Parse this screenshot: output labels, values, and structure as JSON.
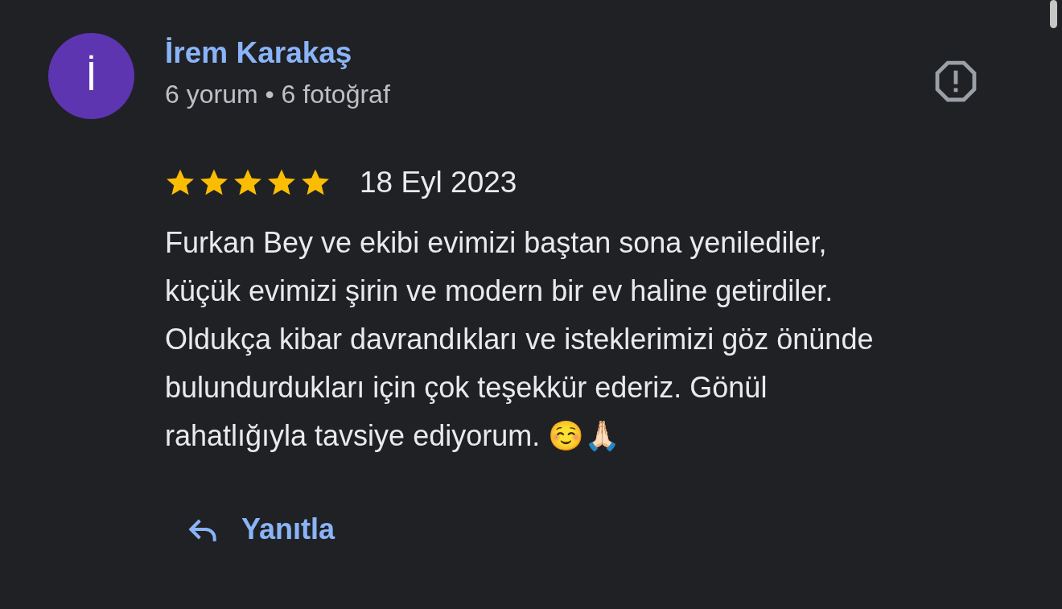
{
  "review": {
    "avatar_letter": "İ",
    "author": "İrem Karakaş",
    "author_meta": "6 yorum • 6 fotoğraf",
    "stars": 5,
    "date": "18 Eyl 2023",
    "text": "Furkan Bey ve ekibi evimizi baştan sona yenilediler,\nküçük evimizi şirin ve modern bir ev haline getirdiler.\nOldukça kibar davrandıkları ve isteklerimizi göz önünde\nbulundurdukları için çok teşekkür ederiz. Gönül\nrahatlığıyla tavsiye ediyorum. ☺️🙏🏻",
    "reply_label": "Yanıtla"
  }
}
